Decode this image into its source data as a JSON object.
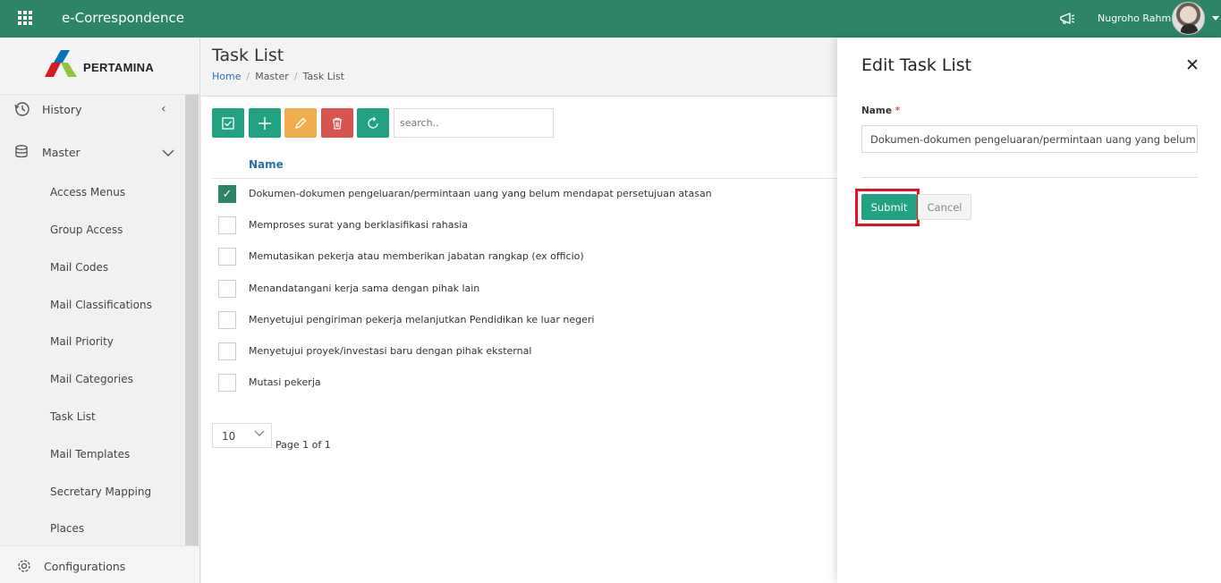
{
  "app": {
    "title": "e-Correspondence"
  },
  "user": {
    "name": "Nugroho Rahm"
  },
  "logo": {
    "text": "PERTAMINA"
  },
  "sidebar": {
    "history_label": "History",
    "master_label": "Master",
    "items": [
      {
        "label": "Access Menus"
      },
      {
        "label": "Group Access"
      },
      {
        "label": "Mail Codes"
      },
      {
        "label": "Mail Classifications"
      },
      {
        "label": "Mail Priority"
      },
      {
        "label": "Mail Categories"
      },
      {
        "label": "Task List"
      },
      {
        "label": "Mail Templates"
      },
      {
        "label": "Secretary Mapping"
      },
      {
        "label": "Places"
      }
    ],
    "configurations_label": "Configurations"
  },
  "page": {
    "title": "Task List",
    "breadcrumb": [
      "Home",
      "Master",
      "Task List"
    ]
  },
  "toolbar": {
    "search_placeholder": "search.."
  },
  "table": {
    "column": "Name",
    "rows": [
      {
        "text": "Dokumen-dokumen pengeluaran/permintaan uang yang belum mendapat persetujuan atasan",
        "checked": true
      },
      {
        "text": "Memproses surat yang berklasifikasi rahasia",
        "checked": false
      },
      {
        "text": "Memutasikan pekerja atau memberikan jabatan rangkap (ex officio)",
        "checked": false
      },
      {
        "text": "Menandatangani kerja sama dengan pihak lain",
        "checked": false
      },
      {
        "text": "Menyetujui pengiriman pekerja melanjutkan Pendidikan ke luar negeri",
        "checked": false
      },
      {
        "text": "Menyetujui proyek/investasi baru dengan pihak eksternal",
        "checked": false
      },
      {
        "text": "Mutasi pekerja",
        "checked": false
      }
    ]
  },
  "pager": {
    "page_size": "10",
    "page_text": "Page 1 of 1"
  },
  "edit_panel": {
    "title": "Edit Task List",
    "name_label": "Name",
    "required_mark": "*",
    "name_value": "Dokumen-dokumen pengeluaran/permintaan uang yang belum mendapat persetujuan atasan",
    "submit_label": "Submit",
    "cancel_label": "Cancel"
  },
  "colors": {
    "topbar": "#2e8466",
    "primary": "#22a183",
    "warning": "#f0ad4e",
    "danger": "#d9534f",
    "highlight": "#e3141f"
  }
}
